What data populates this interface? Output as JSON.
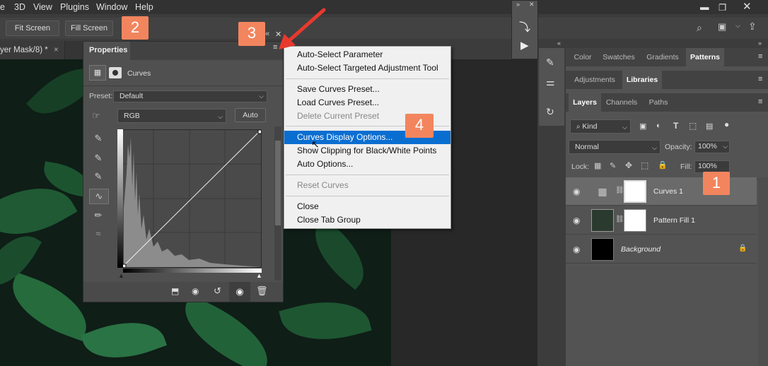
{
  "menubar": {
    "items": [
      "e",
      "3D",
      "View",
      "Plugins",
      "Window",
      "Help"
    ]
  },
  "options_bar": {
    "fit_screen": "Fit Screen",
    "fill_screen": "Fill Screen"
  },
  "document_tab": {
    "title": "yer Mask/8) *",
    "close": "×"
  },
  "properties": {
    "tab": "Properties",
    "adjustment_name": "Curves",
    "preset_label": "Preset:",
    "preset_value": "Default",
    "channel_value": "RGB",
    "auto_button": "Auto"
  },
  "flyout_menu": {
    "items": [
      {
        "label": "Auto-Select Parameter",
        "state": "enabled"
      },
      {
        "label": "Auto-Select Targeted Adjustment Tool",
        "state": "enabled"
      },
      {
        "label": "Save Curves Preset...",
        "state": "enabled"
      },
      {
        "label": "Load Curves Preset...",
        "state": "enabled"
      },
      {
        "label": "Delete Current Preset",
        "state": "disabled"
      },
      {
        "label": "Curves Display Options...",
        "state": "highlighted"
      },
      {
        "label": "Show Clipping for Black/White Points",
        "state": "enabled"
      },
      {
        "label": "Auto Options...",
        "state": "enabled"
      },
      {
        "label": "Reset Curves",
        "state": "disabled"
      },
      {
        "label": "Close",
        "state": "enabled"
      },
      {
        "label": "Close Tab Group",
        "state": "enabled"
      }
    ]
  },
  "badges": [
    "1",
    "2",
    "3",
    "4"
  ],
  "right_panel": {
    "tabs_row1": [
      "Color",
      "Swatches",
      "Gradients",
      "Patterns"
    ],
    "tabs_row2": [
      "Adjustments",
      "Libraries"
    ],
    "tabs_row3": [
      "Layers",
      "Channels",
      "Paths"
    ],
    "kind_filter": "Kind",
    "blend_mode": "Normal",
    "opacity_label": "Opacity:",
    "opacity_value": "100%",
    "lock_label": "Lock:",
    "fill_label": "Fill:",
    "fill_value": "100%",
    "layers": [
      {
        "name": "Curves 1"
      },
      {
        "name": "Pattern Fill 1"
      },
      {
        "name": "Background"
      }
    ]
  },
  "colors": {
    "accent_badge": "#f2855e",
    "menu_highlight": "#0a6ed1",
    "arrow": "#e8392e"
  }
}
